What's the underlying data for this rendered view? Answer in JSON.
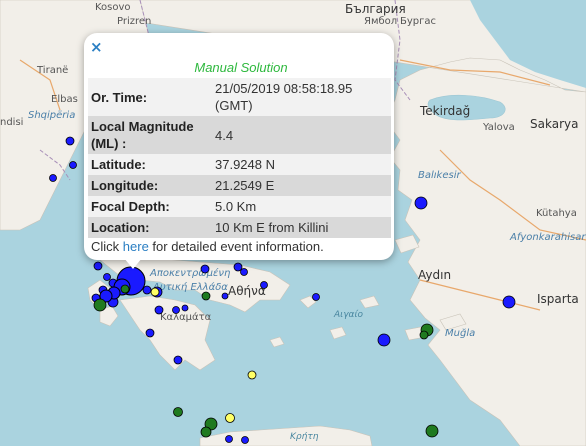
{
  "map_labels": {
    "kosovo": "Kosovo",
    "prizren": "Prizren",
    "bulgaria": "България",
    "yambol": "Ямбол",
    "burgas": "Бургас",
    "tirane": "Tiranë",
    "shqiperia": "Shqipëria",
    "elbas": "Elbas",
    "ndisi": "ndisi",
    "tekirdag": "Tekirdağ",
    "yalova": "Yalova",
    "sakarya": "Sakarya",
    "balikesir": "Balıkesir",
    "kutahya": "Kütahya",
    "afyonkarahisar": "Afyonkarahisar",
    "aydin": "Aydın",
    "isparta": "Isparta",
    "mugla": "Muğla",
    "athina": "Αθήνα",
    "aigaio": "Αιγαίο",
    "kriti": "Κρήτη",
    "dytiki": "Δυτική Ελλάδα",
    "apokentr": "Αποκεντρωμένη",
    "kalamata": "Καλαμάτα"
  },
  "popup": {
    "close_symbol": "×",
    "title": "Manual Solution",
    "rows": [
      {
        "label": "Or. Time:",
        "value": "21/05/2019 08:58:18.95 (GMT)"
      },
      {
        "label": "Local Magnitude (ML) :",
        "value": "4.4"
      },
      {
        "label": "Latitude:",
        "value": "37.9248 N"
      },
      {
        "label": "Longitude:",
        "value": "21.2549 E"
      },
      {
        "label": "Focal Depth:",
        "value": "5.0 Km"
      },
      {
        "label": "Location:",
        "value": "10 Km E from Killini"
      }
    ],
    "click_prefix": "Click ",
    "click_link": "here",
    "click_suffix": " for detailed event information."
  },
  "colors": {
    "sea": "#aad3df",
    "land": "#f2efe9",
    "marker_blue": "#1a1aff",
    "marker_green": "#1f7a1f",
    "marker_yellow": "#ffff66",
    "popup_title": "#2db83d",
    "link": "#2b7fc3"
  }
}
